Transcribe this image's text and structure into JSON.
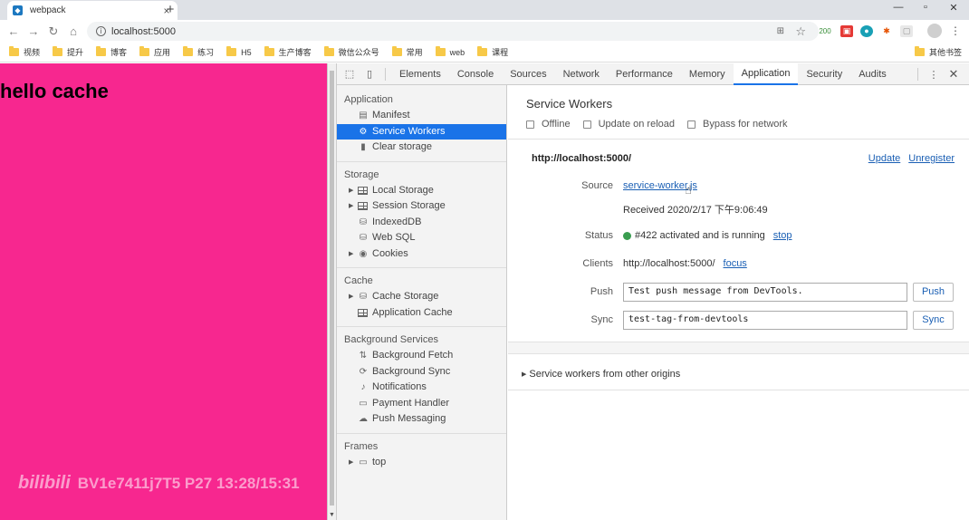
{
  "browser": {
    "tab_title": "webpack",
    "new_tab": "+",
    "url": "localhost:5000",
    "ext_badge": "200",
    "bookmarks": [
      "视频",
      "提升",
      "博客",
      "应用",
      "练习",
      "H5",
      "生产博客",
      "微信公众号",
      "常用",
      "web",
      "课程"
    ],
    "other_bookmarks": "其他书签"
  },
  "page": {
    "heading": "hello cache",
    "background": "#f7278f",
    "watermark_logo": "bilibili",
    "watermark_text": "BV1e7411j7T5 P27 13:28/15:31"
  },
  "devtools": {
    "tabs": [
      "Elements",
      "Console",
      "Sources",
      "Network",
      "Performance",
      "Memory",
      "Application",
      "Security",
      "Audits"
    ],
    "active_tab": "Application",
    "sidebar": {
      "application_header": "Application",
      "application_items": [
        "Manifest",
        "Service Workers",
        "Clear storage"
      ],
      "storage_header": "Storage",
      "storage_items": [
        "Local Storage",
        "Session Storage",
        "IndexedDB",
        "Web SQL",
        "Cookies"
      ],
      "cache_header": "Cache",
      "cache_items": [
        "Cache Storage",
        "Application Cache"
      ],
      "bg_header": "Background Services",
      "bg_items": [
        "Background Fetch",
        "Background Sync",
        "Notifications",
        "Payment Handler",
        "Push Messaging"
      ],
      "frames_header": "Frames",
      "frames_items": [
        "top"
      ]
    },
    "sw": {
      "title": "Service Workers",
      "opt_offline": "Offline",
      "opt_update": "Update on reload",
      "opt_bypass": "Bypass for network",
      "origin": "http://localhost:5000/",
      "update": "Update",
      "unregister": "Unregister",
      "source_label": "Source",
      "source_link": "service-worker.js",
      "received": "Received 2020/2/17 下午9:06:49",
      "status_label": "Status",
      "status_text": "#422 activated and is running",
      "stop": "stop",
      "clients_label": "Clients",
      "clients_url": "http://localhost:5000/",
      "focus": "focus",
      "push_label": "Push",
      "push_value": "Test push message from DevTools.",
      "push_btn": "Push",
      "sync_label": "Sync",
      "sync_value": "test-tag-from-devtools",
      "sync_btn": "Sync",
      "other_origins": "Service workers from other origins"
    }
  }
}
